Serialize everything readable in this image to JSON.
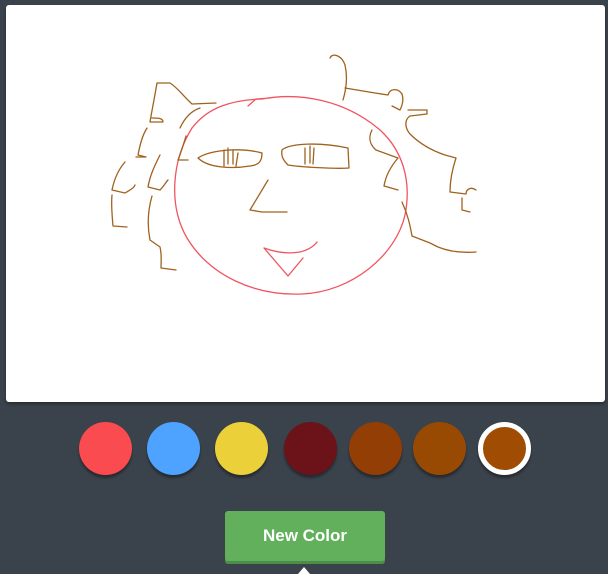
{
  "drawing": {
    "subject": "face-sketch",
    "stroke_colors": [
      "#f0555f",
      "#a0621e",
      "#c0672a"
    ]
  },
  "palette": {
    "colors": [
      "#f94b50",
      "#4da3ff",
      "#ecd03a",
      "#6b1318",
      "#923e05",
      "#994a02",
      "#a04c03"
    ],
    "selected_index": 6
  },
  "new_color_button": {
    "label": "New Color"
  }
}
